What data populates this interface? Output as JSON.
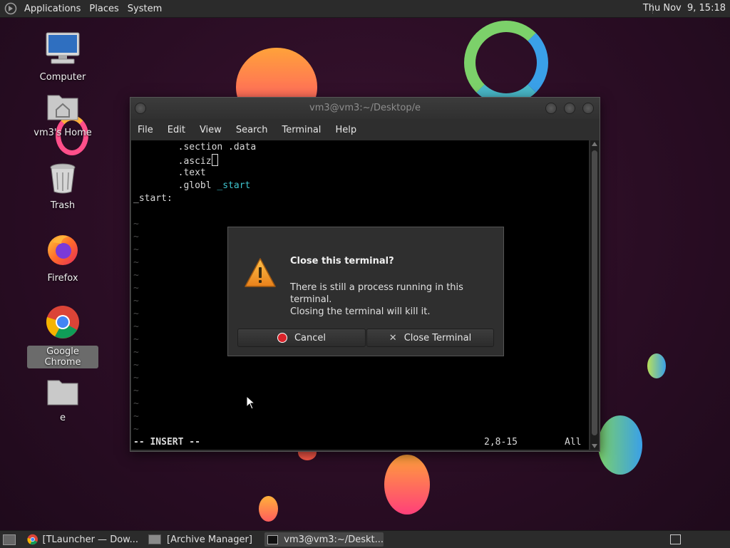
{
  "top_panel": {
    "menus": [
      "Applications",
      "Places",
      "System"
    ],
    "clock": "Thu Nov  9, 15:18"
  },
  "desktop_icons": [
    {
      "label": "Computer"
    },
    {
      "label": "vm3's Home"
    },
    {
      "label": "Trash"
    },
    {
      "label": "Firefox"
    },
    {
      "label": "Google Chrome"
    },
    {
      "label": "e"
    }
  ],
  "terminal": {
    "title": "vm3@vm3:~/Desktop/e",
    "menu": [
      "File",
      "Edit",
      "View",
      "Search",
      "Terminal",
      "Help"
    ],
    "lines": {
      "l1": "        .section .data",
      "l2": "        .asciz",
      "l3": "        .text",
      "l4_a": "        .globl ",
      "l4_b": "_start",
      "l5": "_start:"
    },
    "tilde": "~",
    "status_mode": "-- INSERT --",
    "status_pos": "2,8-15",
    "status_all": "All"
  },
  "dialog": {
    "heading": "Close this terminal?",
    "message_line1": "There is still a process running in this terminal.",
    "message_line2": "Closing the terminal will kill it.",
    "cancel_label": "Cancel",
    "close_label": "Close Terminal"
  },
  "taskbar": {
    "items": [
      {
        "label": "[TLauncher — Dow..."
      },
      {
        "label": "[Archive Manager]"
      },
      {
        "label": "vm3@vm3:~/Deskt..."
      }
    ]
  },
  "colors": {
    "accent_cyan": "#3fc5cf",
    "warning_orange": "#f19a2a",
    "cancel_red": "#d9232a"
  }
}
